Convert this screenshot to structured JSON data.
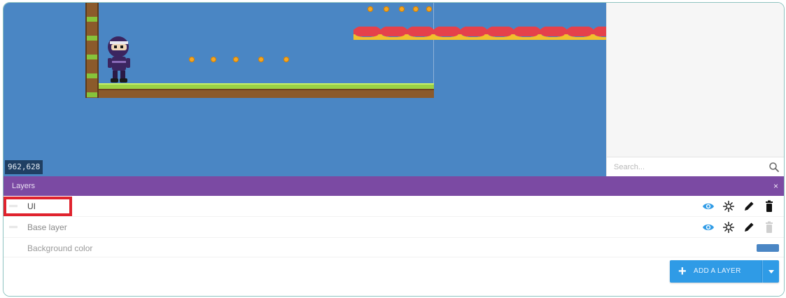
{
  "scene": {
    "cursor_coords": "962,628",
    "background_color": "#4a86c4"
  },
  "side_panel": {
    "search_placeholder": "Search..."
  },
  "layers_panel": {
    "title": "Layers",
    "close_glyph": "×",
    "layers": [
      {
        "name": "UI",
        "highlighted": true
      },
      {
        "name": "Base layer",
        "highlighted": false
      }
    ],
    "background_color_label": "Background color",
    "add_layer_label": "ADD A LAYER",
    "add_layer_plus": "+"
  },
  "icons": {
    "visibility": "eye-icon",
    "effects": "sparkle-icon",
    "edit": "pencil-icon",
    "delete": "trash-icon",
    "search": "search-icon"
  },
  "colors": {
    "header_purple": "#7b4aa3",
    "accent_blue": "#2f9be6",
    "highlight_red": "#e0232e"
  }
}
